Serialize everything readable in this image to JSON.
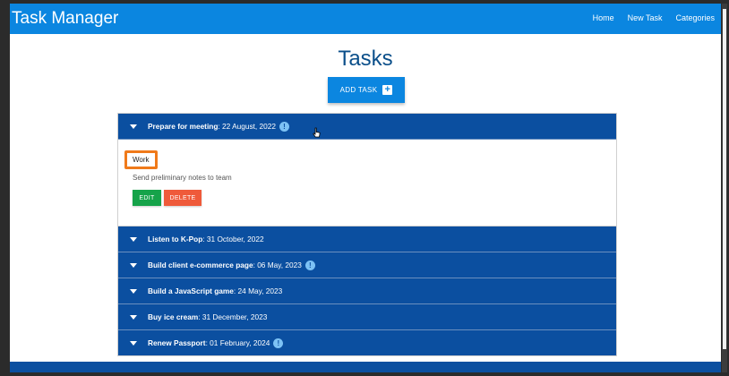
{
  "navbar": {
    "brand": "Task Manager",
    "links": [
      "Home",
      "New Task",
      "Categories"
    ]
  },
  "page": {
    "title": "Tasks",
    "add_button_label": "ADD TASK",
    "add_button_icon": "plus-square-icon"
  },
  "tasks": [
    {
      "title": "Prepare for meeting",
      "date": ": 22 August, 2022",
      "has_info": true,
      "expanded": true,
      "category": "Work",
      "description": "Send preliminary notes to team",
      "edit_label": "EDIT",
      "delete_label": "DELETE"
    },
    {
      "title": "Listen to K-Pop",
      "date": ": 31 October, 2022",
      "has_info": false
    },
    {
      "title": "Build client e-commerce page",
      "date": ": 06 May, 2023",
      "has_info": true
    },
    {
      "title": "Build a JavaScript game",
      "date": ": 24 May, 2023",
      "has_info": false
    },
    {
      "title": "Buy ice cream",
      "date": ": 31 December, 2023",
      "has_info": false
    },
    {
      "title": "Renew Passport",
      "date": ": 01 February, 2024",
      "has_info": true
    }
  ],
  "colors": {
    "navbar": "#0b86e0",
    "task_header": "#0b4fa0",
    "edit": "#16a34a",
    "delete": "#ef5a3a",
    "category_outline": "#f07a1a"
  }
}
